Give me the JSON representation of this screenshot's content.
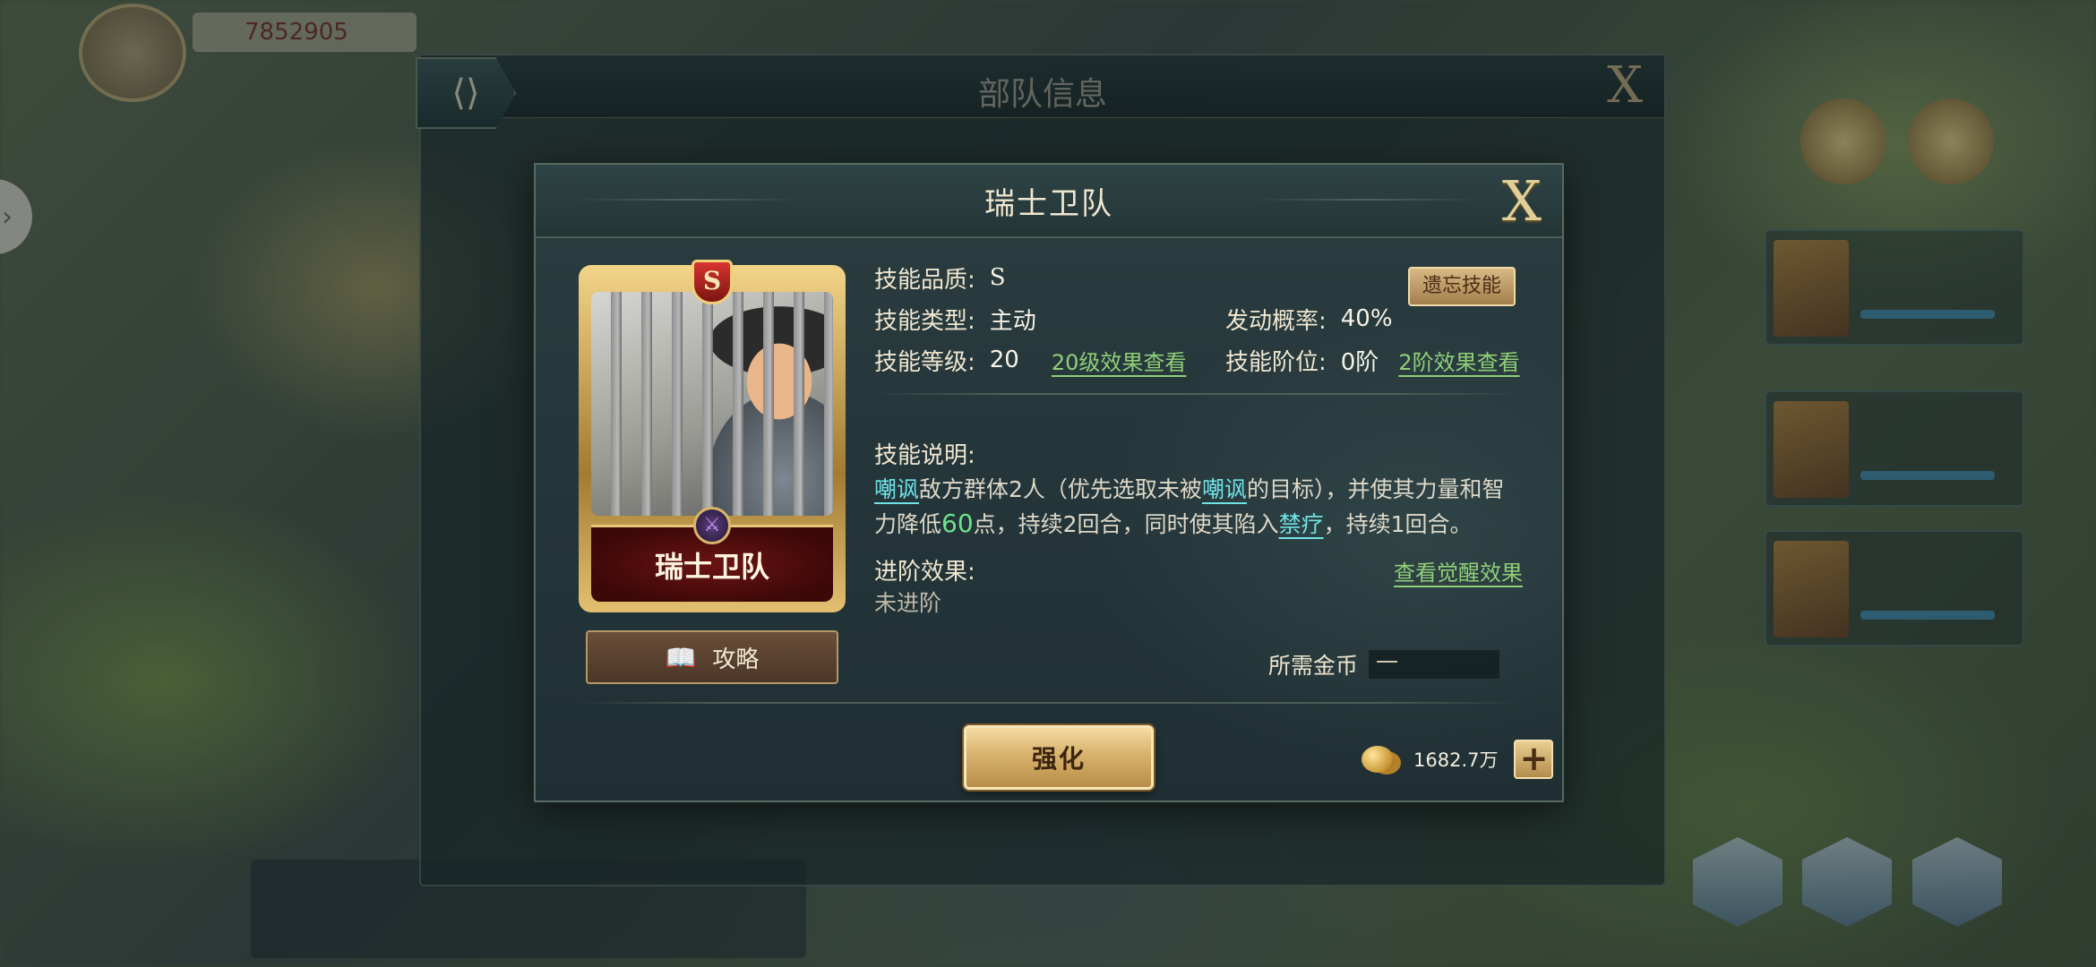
{
  "hud": {
    "currency_value": "7852905"
  },
  "back_panel": {
    "title": "部队信息"
  },
  "modal": {
    "title": "瑞士卫队",
    "close_label": "X"
  },
  "skill_card": {
    "grade": "S",
    "name": "瑞士卫队"
  },
  "guide_button": {
    "label": "攻略"
  },
  "skill_info": {
    "quality_label": "技能品质:",
    "quality_value": "S",
    "type_label": "技能类型:",
    "type_value": "主动",
    "rate_label": "发动概率:",
    "rate_value": "40%",
    "level_label": "技能等级:",
    "level_value": "20",
    "level_link": "20级效果查看",
    "tier_label": "技能阶位:",
    "tier_value": "0阶",
    "tier_link": "2阶效果查看",
    "forget_button": "遗忘技能"
  },
  "description": {
    "label": "技能说明:",
    "kw_taunt": "嘲讽",
    "part1": "敌方群体2人（优先选取未被",
    "part2": "的目标），并使其力量和智力降低",
    "number": "60",
    "part3": "点，持续2回合，同时使其陷入",
    "kw_heal_ban": "禁疗",
    "part4": "，持续1回合。"
  },
  "advancement": {
    "label": "进阶效果:",
    "value": "未进阶",
    "link": "查看觉醒效果"
  },
  "cost": {
    "label": "所需金币",
    "value": "一"
  },
  "actions": {
    "enhance_label": "强化",
    "coin_total": "1682.7万",
    "plus_label": "+"
  },
  "colors": {
    "accent_gold": "#d8b26d",
    "link_green": "#8fcf78",
    "keyword_cyan": "#6fe3e6",
    "number_green": "#6fe38a",
    "card_plate_red": "#6a1413"
  },
  "icons": {
    "share": "share-icon",
    "book": "book-icon",
    "coin": "gold-coin-icon",
    "skill_type": "crossed-swords-icon"
  }
}
